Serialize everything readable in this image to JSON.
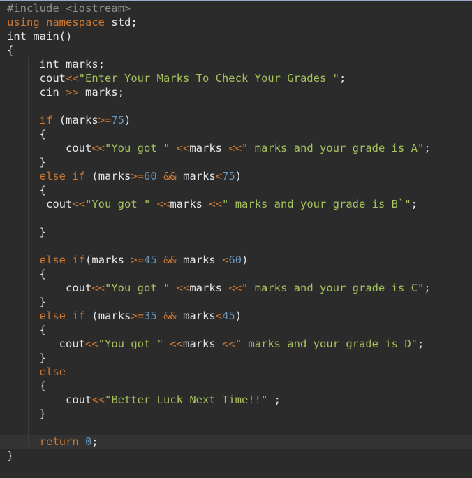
{
  "editor": {
    "lines": [
      [
        [
          "pp",
          "#include <iostream>"
        ]
      ],
      [
        [
          "kw",
          "using"
        ],
        [
          "ws",
          " "
        ],
        [
          "kw",
          "namespace"
        ],
        [
          "ws",
          " "
        ],
        [
          "id",
          "std"
        ],
        [
          "pun",
          ";"
        ]
      ],
      [
        [
          "ty",
          "int"
        ],
        [
          "ws",
          " "
        ],
        [
          "id",
          "main"
        ],
        [
          "pun",
          "()"
        ]
      ],
      [
        [
          "pun",
          "{"
        ]
      ],
      [
        [
          "ws",
          "     "
        ],
        [
          "ty",
          "int"
        ],
        [
          "ws",
          " "
        ],
        [
          "id",
          "marks"
        ],
        [
          "pun",
          ";"
        ]
      ],
      [
        [
          "ws",
          "     "
        ],
        [
          "id",
          "cout"
        ],
        [
          "op",
          "<<"
        ],
        [
          "str",
          "\"Enter Your Marks To Check Your Grades \""
        ],
        [
          "pun",
          ";"
        ]
      ],
      [
        [
          "ws",
          "     "
        ],
        [
          "id",
          "cin"
        ],
        [
          "ws",
          " "
        ],
        [
          "op",
          ">>"
        ],
        [
          "ws",
          " "
        ],
        [
          "id",
          "marks"
        ],
        [
          "pun",
          ";"
        ]
      ],
      [],
      [
        [
          "ws",
          "     "
        ],
        [
          "kw",
          "if"
        ],
        [
          "ws",
          " "
        ],
        [
          "pun",
          "("
        ],
        [
          "id",
          "marks"
        ],
        [
          "op",
          ">="
        ],
        [
          "num",
          "75"
        ],
        [
          "pun",
          ")"
        ]
      ],
      [
        [
          "ws",
          "     "
        ],
        [
          "pun",
          "{"
        ]
      ],
      [
        [
          "ws",
          "         "
        ],
        [
          "id",
          "cout"
        ],
        [
          "op",
          "<<"
        ],
        [
          "str",
          "\"You got \""
        ],
        [
          "ws",
          " "
        ],
        [
          "op",
          "<<"
        ],
        [
          "id",
          "marks"
        ],
        [
          "ws",
          " "
        ],
        [
          "op",
          "<<"
        ],
        [
          "str",
          "\" marks and your grade is A\""
        ],
        [
          "pun",
          ";"
        ]
      ],
      [
        [
          "ws",
          "     "
        ],
        [
          "pun",
          "}"
        ]
      ],
      [
        [
          "ws",
          "     "
        ],
        [
          "kw",
          "else"
        ],
        [
          "ws",
          " "
        ],
        [
          "kw",
          "if"
        ],
        [
          "ws",
          " "
        ],
        [
          "pun",
          "("
        ],
        [
          "id",
          "marks"
        ],
        [
          "op",
          ">="
        ],
        [
          "num",
          "60"
        ],
        [
          "ws",
          " "
        ],
        [
          "op",
          "&&"
        ],
        [
          "ws",
          " "
        ],
        [
          "id",
          "marks"
        ],
        [
          "op",
          "<"
        ],
        [
          "num",
          "75"
        ],
        [
          "pun",
          ")"
        ]
      ],
      [
        [
          "ws",
          "     "
        ],
        [
          "pun",
          "{"
        ]
      ],
      [
        [
          "ws",
          "      "
        ],
        [
          "id",
          "cout"
        ],
        [
          "op",
          "<<"
        ],
        [
          "str",
          "\"You got \""
        ],
        [
          "ws",
          " "
        ],
        [
          "op",
          "<<"
        ],
        [
          "id",
          "marks"
        ],
        [
          "ws",
          " "
        ],
        [
          "op",
          "<<"
        ],
        [
          "str",
          "\" marks and your grade is B`\""
        ],
        [
          "pun",
          ";"
        ]
      ],
      [],
      [
        [
          "ws",
          "     "
        ],
        [
          "pun",
          "}"
        ]
      ],
      [],
      [
        [
          "ws",
          "     "
        ],
        [
          "kw",
          "else"
        ],
        [
          "ws",
          " "
        ],
        [
          "kw",
          "if"
        ],
        [
          "pun",
          "("
        ],
        [
          "id",
          "marks"
        ],
        [
          "ws",
          " "
        ],
        [
          "op",
          ">="
        ],
        [
          "num",
          "45"
        ],
        [
          "ws",
          " "
        ],
        [
          "op",
          "&&"
        ],
        [
          "ws",
          " "
        ],
        [
          "id",
          "marks"
        ],
        [
          "ws",
          " "
        ],
        [
          "op",
          "<"
        ],
        [
          "num",
          "60"
        ],
        [
          "pun",
          ")"
        ]
      ],
      [
        [
          "ws",
          "     "
        ],
        [
          "pun",
          "{"
        ]
      ],
      [
        [
          "ws",
          "         "
        ],
        [
          "id",
          "cout"
        ],
        [
          "op",
          "<<"
        ],
        [
          "str",
          "\"You got \""
        ],
        [
          "ws",
          " "
        ],
        [
          "op",
          "<<"
        ],
        [
          "id",
          "marks"
        ],
        [
          "ws",
          " "
        ],
        [
          "op",
          "<<"
        ],
        [
          "str",
          "\" marks and your grade is C\""
        ],
        [
          "pun",
          ";"
        ]
      ],
      [
        [
          "ws",
          "     "
        ],
        [
          "pun",
          "}"
        ]
      ],
      [
        [
          "ws",
          "     "
        ],
        [
          "kw",
          "else"
        ],
        [
          "ws",
          " "
        ],
        [
          "kw",
          "if"
        ],
        [
          "ws",
          " "
        ],
        [
          "pun",
          "("
        ],
        [
          "id",
          "marks"
        ],
        [
          "op",
          ">="
        ],
        [
          "num",
          "35"
        ],
        [
          "ws",
          " "
        ],
        [
          "op",
          "&&"
        ],
        [
          "ws",
          " "
        ],
        [
          "id",
          "marks"
        ],
        [
          "op",
          "<"
        ],
        [
          "num",
          "45"
        ],
        [
          "pun",
          ")"
        ]
      ],
      [
        [
          "ws",
          "     "
        ],
        [
          "pun",
          "{"
        ]
      ],
      [
        [
          "ws",
          "        "
        ],
        [
          "id",
          "cout"
        ],
        [
          "op",
          "<<"
        ],
        [
          "str",
          "\"You got \""
        ],
        [
          "ws",
          " "
        ],
        [
          "op",
          "<<"
        ],
        [
          "id",
          "marks"
        ],
        [
          "ws",
          " "
        ],
        [
          "op",
          "<<"
        ],
        [
          "str",
          "\" marks and your grade is D\""
        ],
        [
          "pun",
          ";"
        ]
      ],
      [
        [
          "ws",
          "     "
        ],
        [
          "pun",
          "}"
        ]
      ],
      [
        [
          "ws",
          "     "
        ],
        [
          "kw",
          "else"
        ]
      ],
      [
        [
          "ws",
          "     "
        ],
        [
          "pun",
          "{"
        ]
      ],
      [
        [
          "ws",
          "         "
        ],
        [
          "id",
          "cout"
        ],
        [
          "op",
          "<<"
        ],
        [
          "str",
          "\"Better Luck Next Time!!\""
        ],
        [
          "ws",
          " "
        ],
        [
          "pun",
          ";"
        ]
      ],
      [
        [
          "ws",
          "     "
        ],
        [
          "pun",
          "}"
        ]
      ],
      [],
      [
        [
          "ws",
          "     "
        ],
        [
          "kw",
          "return"
        ],
        [
          "ws",
          " "
        ],
        [
          "num",
          "0"
        ],
        [
          "pun",
          ";"
        ]
      ],
      [
        [
          "pun",
          "}"
        ]
      ]
    ],
    "current_line": 31,
    "colors": {
      "background": "#2b2b2b",
      "current_line": "#333333",
      "keyword": "#cc7832",
      "preprocessor": "#8d8d8d",
      "number": "#6897bb",
      "string": "#a5c25c",
      "text": "#e6e6e6",
      "top_border": "#9aa9c8"
    }
  }
}
